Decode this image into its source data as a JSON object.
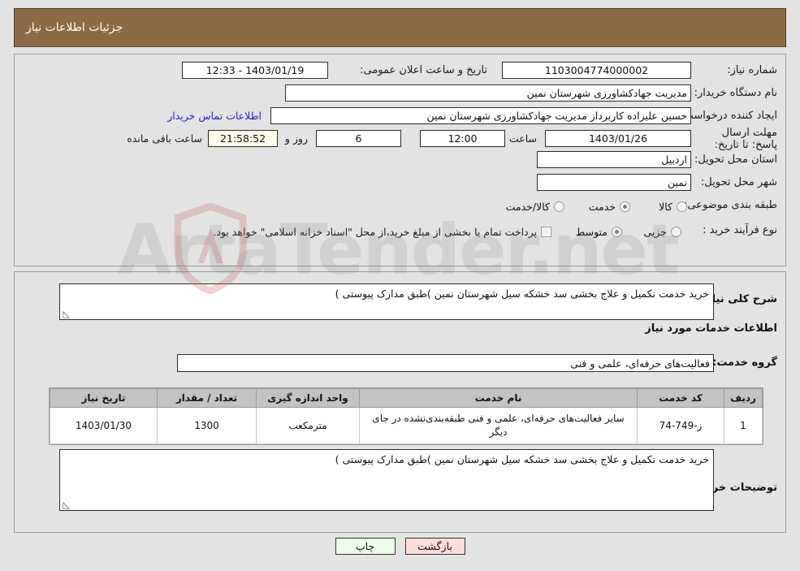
{
  "header": {
    "title": "جزئیات اطلاعات نیاز"
  },
  "fields": {
    "need_number_label": "شماره نیاز:",
    "need_number_value": "1103004774000002",
    "announce_label": "تاریخ و ساعت اعلان عمومی:",
    "announce_value": "1403/01/19 - 12:33",
    "buyer_org_label": "نام دستگاه خریدار:",
    "buyer_org_value": "مدیریت جهادکشاورزی شهرستان نمین",
    "buyer_org_value_2": "مدیریت جهادکشاورزی شهرستان نمین",
    "creator_label": "ایجاد کننده درخواست:",
    "creator_value": "حسین علیزاده کاربرداز مدیریت جهادکشاورزی شهرستان نمین",
    "contact_link": "اطلاعات تماس خریدار",
    "deadline_label": "مهلت ارسال پاسخ: تا تاریخ:",
    "deadline_date": "1403/01/26",
    "hour_label": "ساعت",
    "deadline_time": "12:00",
    "days_value": "6",
    "days_label": "روز و",
    "timer_value": "21:58:52",
    "remaining_label": "ساعت باقی مانده",
    "province_label": "استان محل تحویل:",
    "province_value": "اردبیل",
    "city_label": "شهر محل تحویل:",
    "city_value": "نمین",
    "category_label": "طبقه بندی موضوعی:",
    "category_options": [
      "کالا",
      "خدمت",
      "کالا/خدمت"
    ],
    "category_selected_index": 1,
    "purchase_type_label": "نوع فرآیند خرید :",
    "purchase_type_options": [
      "جزیی",
      "متوسط"
    ],
    "purchase_type_selected_index": 1,
    "treasury_note": "پرداخت تمام یا بخشی از مبلغ خرید،از محل \"اسناد خزانه اسلامی\" خواهد بود.",
    "treasury_checked": false
  },
  "description": {
    "label": "شرح کلی نیاز:",
    "value": "خرید خدمت تکمیل و علاج بخشی سد خشکه سیل  شهرستان نمین )طبق مدارک پیوستی )"
  },
  "services_section": {
    "heading": "اطلاعات خدمات مورد نیاز",
    "group_label": "گروه خدمت:",
    "group_value": "فعالیت‌های حرفه‌ای، علمی و فنی"
  },
  "table": {
    "headers": [
      "ردیف",
      "کد خدمت",
      "نام خدمت",
      "واحد اندازه گیری",
      "تعداد / مقدار",
      "تاریخ نیاز"
    ],
    "rows": [
      {
        "row": "1",
        "code": "ز-749-74",
        "name": "سایر فعالیت‌های حرفه‌ای، علمی و فنی طبقه‌بندی‌نشده در جای دیگر",
        "unit": "مترمکعب",
        "qty": "1300",
        "date": "1403/01/30"
      }
    ]
  },
  "buyer_notes": {
    "label": "توضیحات خریدار:",
    "value": "خرید خدمت تکمیل و علاج بخشی سد خشکه سیل  شهرستان نمین )طبق مدارک پیوستی )"
  },
  "buttons": {
    "print": "چاپ",
    "back": "بازگشت"
  },
  "watermark": {
    "text": "ArtaTender.net"
  },
  "colors": {
    "header_bg": "#8b6b43",
    "page_bg": "#e3e3e3",
    "link": "#2222cc",
    "timer_bg": "#ffffea",
    "print_btn": "#eefbe6",
    "back_btn": "#ffdcdc",
    "table_header_bg": "#c3c3c3"
  }
}
